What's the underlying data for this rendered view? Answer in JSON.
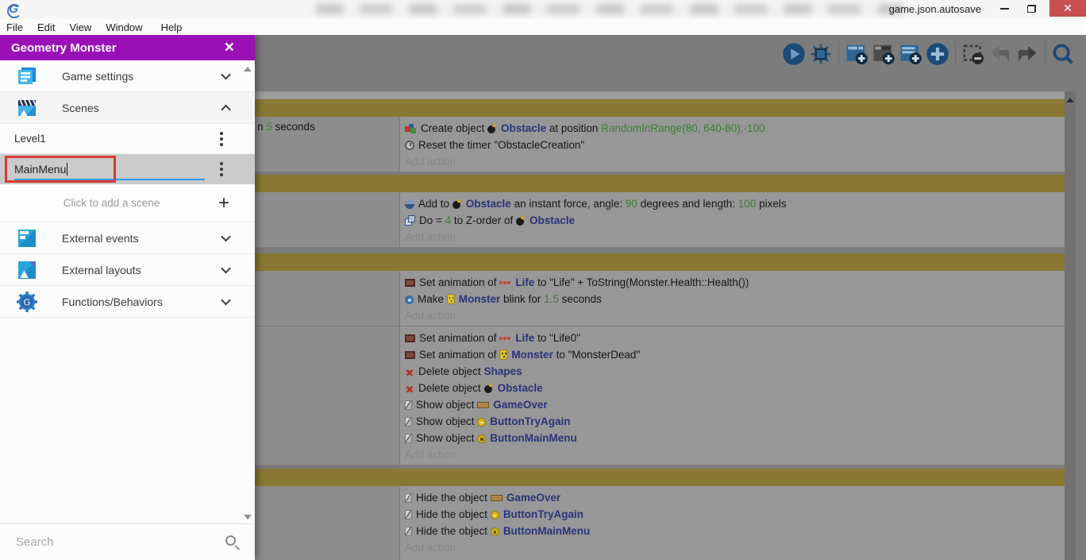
{
  "window": {
    "title": "game.json.autosave",
    "controls": {
      "minimize": "minimize",
      "restore": "restore",
      "close": "close"
    }
  },
  "menu": {
    "items": [
      "File",
      "Edit",
      "View",
      "Window",
      "Help"
    ]
  },
  "drawer": {
    "title": "Geometry Monster",
    "close_label": "×",
    "items": [
      {
        "label": "Game settings",
        "icon": "game-settings-icon",
        "state": "collapsed"
      },
      {
        "label": "Scenes",
        "icon": "scenes-icon",
        "state": "expanded"
      }
    ],
    "scenes": {
      "rows": [
        {
          "label": "Level1",
          "editing": false
        },
        {
          "label": "MainMenu",
          "editing": true,
          "selected": true
        }
      ],
      "add_label": "Click to add a scene"
    },
    "items2": [
      {
        "label": "External events",
        "icon": "external-events-icon",
        "state": "collapsed"
      },
      {
        "label": "External layouts",
        "icon": "external-layouts-icon",
        "state": "collapsed"
      },
      {
        "label": "Functions/Behaviors",
        "icon": "functions-behaviors-icon",
        "state": "collapsed"
      }
    ],
    "search_placeholder": "Search"
  },
  "toolbar": {
    "icons": [
      "play",
      "debug-bug",
      "add-event",
      "add-subevent",
      "add-comment",
      "add-circle",
      "remove-event",
      "undo",
      "redo",
      "search"
    ]
  },
  "colors": {
    "accent_purple": "#9a10b7",
    "group_bar_olive": "#887832",
    "annotation_red": "#d93a35",
    "underline_blue": "#2e9bea",
    "object_blue": "#283577",
    "param_green": "#3e7d37"
  },
  "events": [
    {
      "type": "group"
    },
    {
      "type": "event",
      "conditions": [
        {
          "t": "n "
        },
        {
          "t": "5",
          "s": "green"
        },
        {
          "t": " seconds"
        }
      ],
      "lines": [
        {
          "icon": "create",
          "parts": [
            {
              "t": "Create object "
            },
            {
              "icon": "bomb"
            },
            {
              "t": "Obstacle",
              "s": "object"
            },
            {
              "t": " at position "
            },
            {
              "t": "RandomInRange(80, 640-80);-100",
              "s": "green"
            }
          ]
        },
        {
          "icon": "timer",
          "parts": [
            {
              "t": "Reset the timer \"ObstacleCreation\""
            }
          ]
        }
      ],
      "add_action": "Add action"
    },
    {
      "type": "gap",
      "cls": "g4"
    },
    {
      "type": "group"
    },
    {
      "type": "event",
      "conditions": [],
      "lines": [
        {
          "icon": "force",
          "parts": [
            {
              "t": "Add to "
            },
            {
              "icon": "bomb"
            },
            {
              "t": "Obstacle",
              "s": "object"
            },
            {
              "t": " an instant force, angle: "
            },
            {
              "t": "90",
              "s": "green"
            },
            {
              "t": " degrees and length: "
            },
            {
              "t": "100",
              "s": "green"
            },
            {
              "t": " pixels"
            }
          ]
        },
        {
          "icon": "zorder",
          "parts": [
            {
              "t": "Do "
            },
            {
              "t": "= "
            },
            {
              "t": "4",
              "s": "green"
            },
            {
              "t": " to Z-order of "
            },
            {
              "icon": "bomb"
            },
            {
              "t": "Obstacle",
              "s": "object"
            }
          ]
        }
      ],
      "add_action": "Add action"
    },
    {
      "type": "gap",
      "cls": "g8"
    },
    {
      "type": "group"
    },
    {
      "type": "event",
      "conditions": [],
      "lines": [
        {
          "icon": "anim",
          "parts": [
            {
              "t": "Set animation of "
            },
            {
              "icon": "life"
            },
            {
              "t": "Life",
              "s": "object"
            },
            {
              "t": " to \"Life\" + ToString(Monster.Health::Health())"
            }
          ]
        },
        {
          "icon": "blink",
          "parts": [
            {
              "t": "Make "
            },
            {
              "icon": "monster"
            },
            {
              "t": "Monster",
              "s": "object"
            },
            {
              "t": " blink for "
            },
            {
              "t": "1.5",
              "s": "green"
            },
            {
              "t": " seconds"
            }
          ]
        }
      ],
      "add_action": "Add action"
    },
    {
      "type": "event",
      "attached": true,
      "conditions": [],
      "lines": [
        {
          "icon": "anim",
          "parts": [
            {
              "t": "Set animation of "
            },
            {
              "icon": "life"
            },
            {
              "t": "Life",
              "s": "object"
            },
            {
              "t": " to \"Life0\""
            }
          ]
        },
        {
          "icon": "anim",
          "parts": [
            {
              "t": "Set animation of "
            },
            {
              "icon": "monster"
            },
            {
              "t": "Monster",
              "s": "object"
            },
            {
              "t": " to \"MonsterDead\""
            }
          ]
        },
        {
          "icon": "del",
          "parts": [
            {
              "t": "Delete object "
            },
            {
              "t": "Shapes",
              "s": "object"
            }
          ]
        },
        {
          "icon": "del",
          "parts": [
            {
              "t": "Delete object "
            },
            {
              "icon": "bomb"
            },
            {
              "t": "Obstacle",
              "s": "object"
            }
          ]
        },
        {
          "icon": "vis",
          "parts": [
            {
              "t": "Show object "
            },
            {
              "icon": "banner"
            },
            {
              "t": "GameOver",
              "s": "object"
            }
          ]
        },
        {
          "icon": "vis",
          "parts": [
            {
              "t": "Show object "
            },
            {
              "icon": "btn"
            },
            {
              "t": "ButtonTryAgain",
              "s": "object"
            }
          ]
        },
        {
          "icon": "vis",
          "parts": [
            {
              "t": "Show object "
            },
            {
              "icon": "btnm"
            },
            {
              "t": "ButtonMainMenu",
              "s": "object"
            }
          ]
        }
      ],
      "add_action": "Add action"
    },
    {
      "type": "gap",
      "cls": "g5"
    },
    {
      "type": "group"
    },
    {
      "type": "event",
      "fill": true,
      "conditions": [],
      "lines": [
        {
          "icon": "vis",
          "parts": [
            {
              "t": "Hide the object "
            },
            {
              "icon": "banner"
            },
            {
              "t": "GameOver",
              "s": "object"
            }
          ]
        },
        {
          "icon": "vis",
          "parts": [
            {
              "t": "Hide the object "
            },
            {
              "icon": "btn"
            },
            {
              "t": "ButtonTryAgain",
              "s": "object"
            }
          ]
        },
        {
          "icon": "vis",
          "parts": [
            {
              "t": "Hide the object "
            },
            {
              "icon": "btnm"
            },
            {
              "t": "ButtonMainMenu",
              "s": "object"
            }
          ]
        }
      ],
      "add_action": "Add action"
    }
  ]
}
